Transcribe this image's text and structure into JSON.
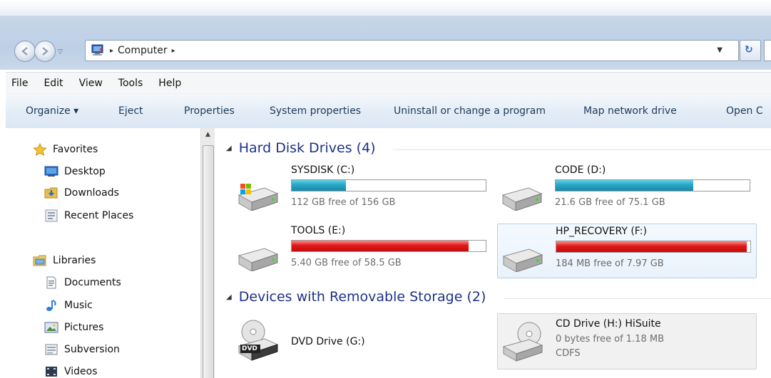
{
  "address_bar": {
    "path_label": "Computer",
    "sep_left": "▸",
    "sep_right": "▸",
    "refresh_glyph": "↻"
  },
  "menu": {
    "items": [
      "File",
      "Edit",
      "View",
      "Tools",
      "Help"
    ]
  },
  "toolbar": {
    "items": [
      "Organize ▾",
      "Eject",
      "Properties",
      "System properties",
      "Uninstall or change a program",
      "Map network drive",
      "Open C"
    ]
  },
  "nav": {
    "favorites": "Favorites",
    "desktop": "Desktop",
    "downloads": "Downloads",
    "recent": "Recent Places",
    "libraries": "Libraries",
    "documents": "Documents",
    "music": "Music",
    "pictures": "Pictures",
    "subversion": "Subversion",
    "videos": "Videos"
  },
  "groups": {
    "hdd": "Hard Disk Drives (4)",
    "removable": "Devices with Removable Storage (2)"
  },
  "drives": [
    {
      "name": "SYSDISK (C:)",
      "free": "112 GB free of 156 GB",
      "used_fraction": 0.28,
      "color": "blue"
    },
    {
      "name": "CODE (D:)",
      "free": "21.6 GB free of 75.1 GB",
      "used_fraction": 0.71,
      "color": "blue"
    },
    {
      "name": "TOOLS (E:)",
      "free": "5.40 GB free of 58.5 GB",
      "used_fraction": 0.91,
      "color": "red"
    },
    {
      "name": "HP_RECOVERY (F:)",
      "free": "184 MB free of 7.97 GB",
      "used_fraction": 0.98,
      "color": "red"
    }
  ],
  "removable": [
    {
      "name": "DVD Drive (G:)",
      "badge": "DVD"
    },
    {
      "name": "CD Drive (H:) HiSuite",
      "free": "0 bytes free of 1.18 MB",
      "fs": "CDFS"
    }
  ],
  "colors": {
    "group_heading": "#1e3287",
    "bar_blue": "#27a6c4",
    "bar_red": "#e01818"
  }
}
